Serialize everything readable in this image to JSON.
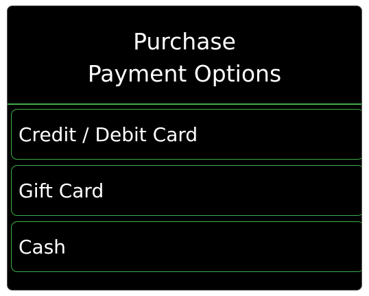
{
  "header": {
    "title_line1": "Purchase",
    "title_line2": "Payment Options"
  },
  "options": [
    {
      "label": "Credit / Debit Card"
    },
    {
      "label": "Gift Card"
    },
    {
      "label": "Cash"
    }
  ],
  "colors": {
    "background": "#000000",
    "accent": "#3fae49",
    "text": "#ffffff"
  }
}
